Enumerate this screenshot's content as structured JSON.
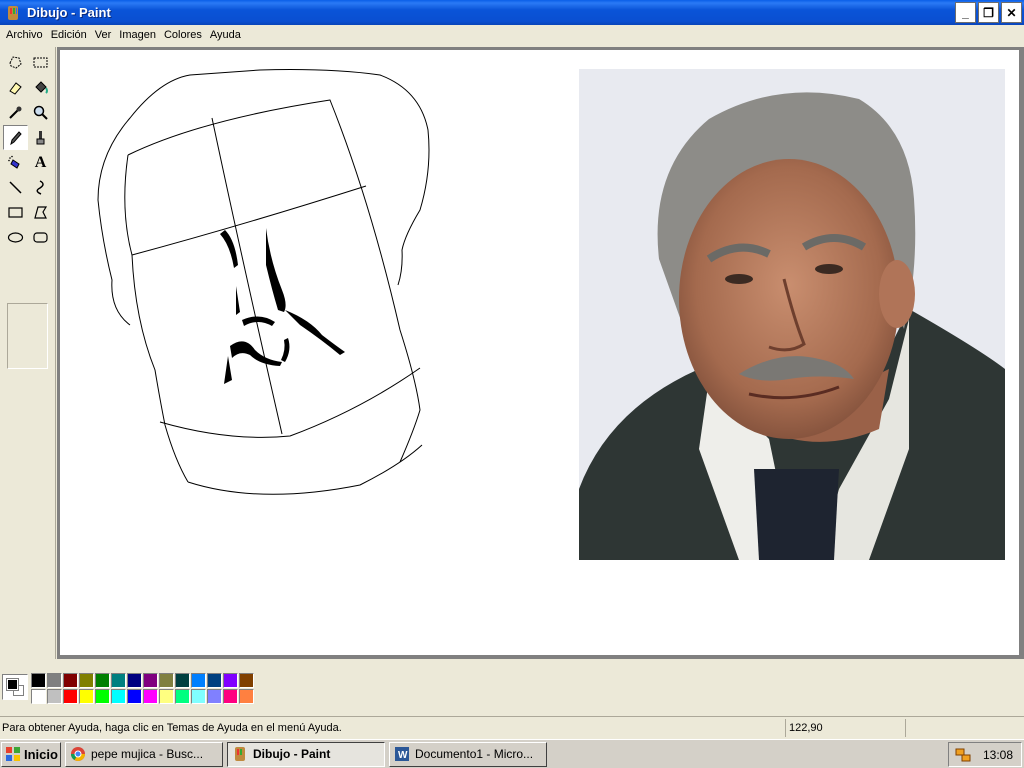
{
  "window": {
    "title": "Dibujo - Paint",
    "minimize": "_",
    "restore": "❐",
    "close": "✕"
  },
  "menu": [
    "Archivo",
    "Edición",
    "Ver",
    "Imagen",
    "Colores",
    "Ayuda"
  ],
  "tools": [
    {
      "name": "free-select-icon"
    },
    {
      "name": "rect-select-icon"
    },
    {
      "name": "eraser-icon"
    },
    {
      "name": "fill-bucket-icon"
    },
    {
      "name": "color-picker-icon"
    },
    {
      "name": "magnifier-icon"
    },
    {
      "name": "pencil-icon",
      "active": true
    },
    {
      "name": "brush-icon"
    },
    {
      "name": "airbrush-icon"
    },
    {
      "name": "text-icon",
      "label": "A"
    },
    {
      "name": "line-icon"
    },
    {
      "name": "curve-icon"
    },
    {
      "name": "rectangle-icon"
    },
    {
      "name": "polygon-icon"
    },
    {
      "name": "ellipse-icon"
    },
    {
      "name": "rounded-rect-icon"
    }
  ],
  "palette": {
    "foreground": "#000000",
    "background": "#ffffff",
    "row1": [
      "#000000",
      "#808080",
      "#800000",
      "#808000",
      "#008000",
      "#008080",
      "#000080",
      "#800080",
      "#808040",
      "#004040",
      "#0080ff",
      "#004080",
      "#8000ff",
      "#804000"
    ],
    "row2": [
      "#ffffff",
      "#c0c0c0",
      "#ff0000",
      "#ffff00",
      "#00ff00",
      "#00ffff",
      "#0000ff",
      "#ff00ff",
      "#ffff80",
      "#00ff80",
      "#80ffff",
      "#8080ff",
      "#ff0080",
      "#ff8040"
    ]
  },
  "status": {
    "help": "Para obtener Ayuda, haga clic en Temas de Ayuda en el menú Ayuda.",
    "coords": "122,90"
  },
  "taskbar": {
    "start": "Inicio",
    "tasks": [
      {
        "label": "pepe mujica - Busc...",
        "icon": "chrome-icon"
      },
      {
        "label": "Dibujo - Paint",
        "icon": "paint-icon",
        "active": true
      },
      {
        "label": "Documento1 - Micro...",
        "icon": "word-icon"
      }
    ],
    "clock": "13:08"
  }
}
